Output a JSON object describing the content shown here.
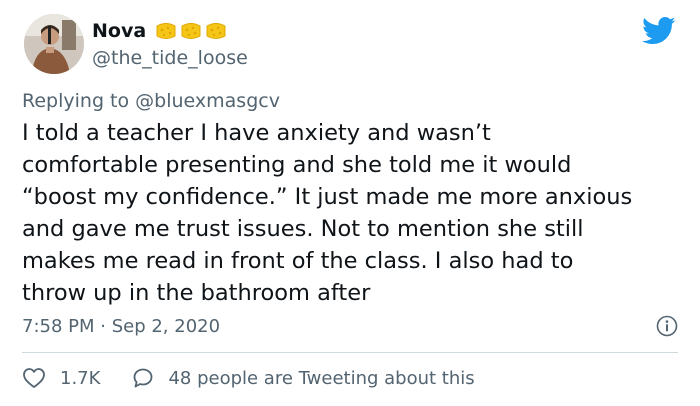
{
  "user": {
    "display_name": "Nova",
    "handle": "@the_tide_loose",
    "avatar_icon": "avatar-photo",
    "badge_icons": [
      "sponge-emoji",
      "sponge-emoji",
      "sponge-emoji"
    ],
    "badge_color": "#f5c518"
  },
  "brand": {
    "icon": "twitter-bird-icon",
    "color": "#1d9bf0"
  },
  "reply": {
    "prefix": "Replying to",
    "mention": "@bluexmasgcv"
  },
  "tweet": {
    "text": "I told a teacher I have anxiety and wasn’t\ncomfortable presenting and she told me it would\n“boost my confidence.” It just made me more anxious\nand gave me trust issues. Not to mention she still\nmakes me read in front of the class. I also had to\nthrow up in the bathroom after",
    "timestamp": "7:58 PM · Sep 2, 2020"
  },
  "actions": {
    "like_count": "1.7K",
    "conversation_text": "48 people are Tweeting about this"
  },
  "colors": {
    "text": "#0f1419",
    "secondary": "#536471",
    "divider": "#cfd9de"
  }
}
